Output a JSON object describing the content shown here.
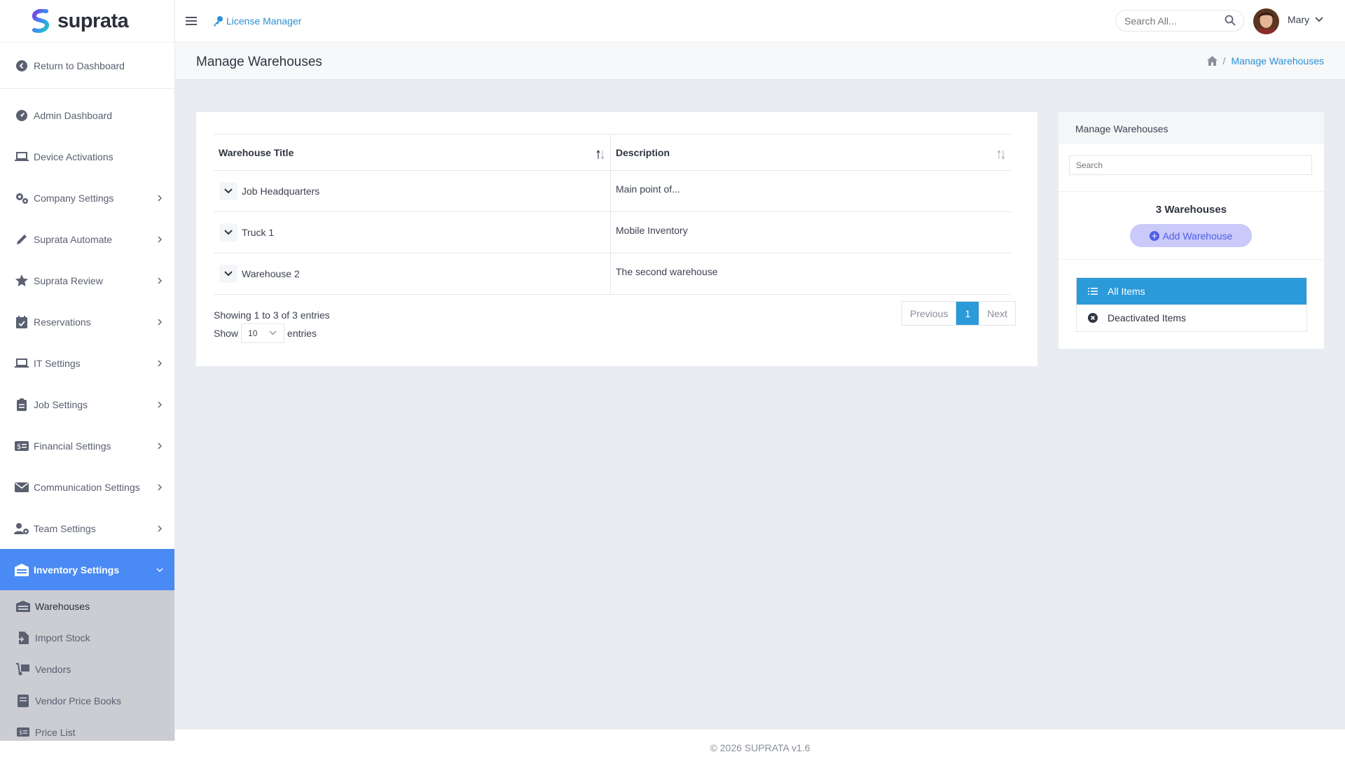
{
  "app": {
    "logo_text": "suprata"
  },
  "sidebar": {
    "return_label": "Return to Dashboard",
    "items": [
      {
        "label": "Admin Dashboard",
        "icon": "gauge-icon",
        "chevron": false
      },
      {
        "label": "Device Activations",
        "icon": "laptop-icon",
        "chevron": false
      },
      {
        "label": "Company Settings",
        "icon": "gears-icon",
        "chevron": true
      },
      {
        "label": "Suprata Automate",
        "icon": "pencil-icon",
        "chevron": true
      },
      {
        "label": "Suprata Review",
        "icon": "star-icon",
        "chevron": true
      },
      {
        "label": "Reservations",
        "icon": "calendar-check-icon",
        "chevron": true
      },
      {
        "label": "IT Settings",
        "icon": "laptop-icon",
        "chevron": true
      },
      {
        "label": "Job Settings",
        "icon": "clipboard-icon",
        "chevron": true
      },
      {
        "label": "Financial Settings",
        "icon": "money-card-icon",
        "chevron": true
      },
      {
        "label": "Communication Settings",
        "icon": "envelope-icon",
        "chevron": true
      },
      {
        "label": "Team Settings",
        "icon": "user-gear-icon",
        "chevron": true
      },
      {
        "label": "Inventory Settings",
        "icon": "warehouse-icon",
        "chevron": true
      }
    ],
    "subitems": [
      {
        "label": "Warehouses",
        "icon": "warehouse-icon"
      },
      {
        "label": "Import Stock",
        "icon": "file-import-icon"
      },
      {
        "label": "Vendors",
        "icon": "truck-dolly-icon"
      },
      {
        "label": "Vendor Price Books",
        "icon": "book-icon"
      },
      {
        "label": "Price List",
        "icon": "money-card-icon"
      }
    ]
  },
  "topbar": {
    "license_label": "License Manager",
    "search_placeholder": "Search All...",
    "user_name": "Mary"
  },
  "page": {
    "title": "Manage Warehouses",
    "breadcrumb_current": "Manage Warehouses"
  },
  "table": {
    "columns": [
      "Warehouse Title",
      "Description"
    ],
    "rows": [
      {
        "title": "Job Headquarters",
        "description": "Main point of..."
      },
      {
        "title": "Truck 1",
        "description": "Mobile Inventory"
      },
      {
        "title": "Warehouse 2",
        "description": "The second warehouse"
      }
    ],
    "info": "Showing 1 to 3 of 3 entries",
    "show_label": "Show",
    "show_value": "10",
    "entries_label": "entries",
    "pager": {
      "previous": "Previous",
      "current": "1",
      "next": "Next"
    }
  },
  "panel": {
    "title": "Manage Warehouses",
    "search_placeholder": "Search",
    "count": "3 Warehouses",
    "add_label": "Add Warehouse",
    "filters": [
      {
        "label": "All Items",
        "active": true
      },
      {
        "label": "Deactivated Items",
        "active": false
      }
    ]
  },
  "footer": {
    "text": "© 2026 SUPRATA v1.6"
  },
  "colors": {
    "accent": "#2b9ad8",
    "active_nav": "#4a8af4",
    "add_button": "#c9c9fa"
  }
}
